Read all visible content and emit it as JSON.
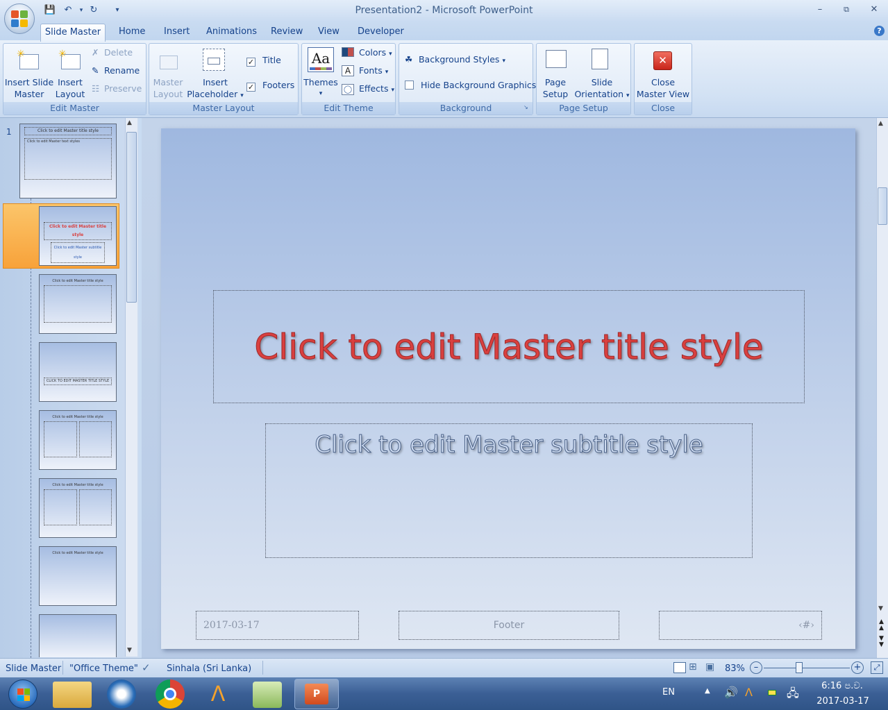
{
  "window": {
    "title": "Presentation2 - Microsoft PowerPoint"
  },
  "tabs": [
    "Slide Master",
    "Home",
    "Insert",
    "Animations",
    "Review",
    "View",
    "Developer"
  ],
  "ribbon": {
    "edit_master": {
      "label": "Edit Master",
      "insert_slide_master": [
        "Insert Slide",
        "Master"
      ],
      "insert_layout": [
        "Insert",
        "Layout"
      ],
      "delete": "Delete",
      "rename": "Rename",
      "preserve": "Preserve"
    },
    "master_layout": {
      "label": "Master Layout",
      "master_layout_btn": [
        "Master",
        "Layout"
      ],
      "insert_placeholder": [
        "Insert",
        "Placeholder"
      ],
      "title_check": "Title",
      "footers_check": "Footers"
    },
    "edit_theme": {
      "label": "Edit Theme",
      "themes": "Themes",
      "colors": "Colors",
      "fonts": "Fonts",
      "effects": "Effects"
    },
    "background": {
      "label": "Background",
      "background_styles": "Background Styles",
      "hide_background_graphics": "Hide Background Graphics"
    },
    "page_setup": {
      "label": "Page Setup",
      "page_setup_btn": [
        "Page",
        "Setup"
      ],
      "slide_orientation": [
        "Slide",
        "Orientation"
      ]
    },
    "close": {
      "label": "Close",
      "close_master_view": [
        "Close",
        "Master View"
      ]
    }
  },
  "thumbnails": {
    "slide_number": "1",
    "t1_title": "Click to edit Master title style",
    "t1_body": "Click to edit Master text styles",
    "t2_title": "Click to edit Master title style",
    "t2_sub": "Click to edit Master subtitle style",
    "generic_title": "Click to edit Master title style",
    "t4_title": "CLICK TO EDIT MASTER TITLE STYLE"
  },
  "slide": {
    "title": "Click to edit Master title style",
    "subtitle": "Click to edit Master subtitle style",
    "date": "2017-03-17",
    "footer": "Footer",
    "page_number": "‹#›"
  },
  "status": {
    "view": "Slide Master",
    "theme": "\"Office Theme\"",
    "language": "Sinhala (Sri Lanka)",
    "zoom": "83%"
  },
  "taskbar": {
    "lang": "EN",
    "time": "6:16 ප.ව.",
    "date": "2017-03-17"
  },
  "colors": {
    "accent": "#15428b",
    "title_red": "#d9403f",
    "selection": "#f8a23a"
  }
}
